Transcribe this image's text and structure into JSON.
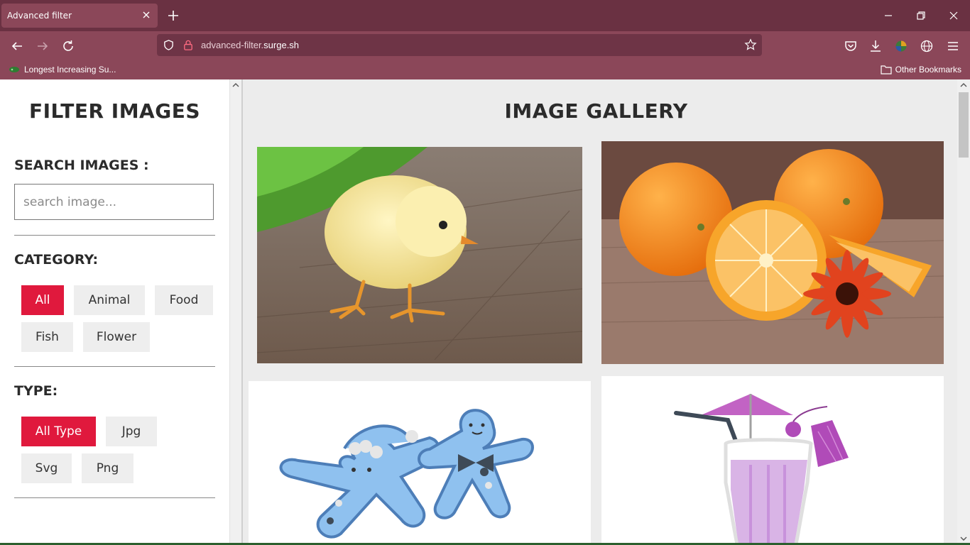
{
  "browser": {
    "tab_title": "Advanced filter",
    "url_prefix": "advanced-filter.",
    "url_domain": "surge.sh",
    "bookmark_item": "Longest Increasing Su...",
    "other_bookmarks": "Other Bookmarks"
  },
  "sidebar": {
    "title": "FILTER IMAGES",
    "search_label": "SEARCH IMAGES :",
    "search_placeholder": "search image...",
    "category_label": "CATEGORY:",
    "categories": [
      "All",
      "Animal",
      "Food",
      "Fish",
      "Flower"
    ],
    "active_category": "All",
    "type_label": "TYPE:",
    "types": [
      "All Type",
      "Jpg",
      "Svg",
      "Png"
    ],
    "active_type": "All Type"
  },
  "gallery": {
    "title": "IMAGE GALLERY",
    "images": [
      {
        "subject": "yellow chick on wooden planks"
      },
      {
        "subject": "oranges with red gerbera flower"
      },
      {
        "subject": "blue gingerbread cookies illustration"
      },
      {
        "subject": "purple cocktail with umbrella illustration"
      }
    ]
  },
  "colors": {
    "accent": "#e0193d",
    "chrome_dark": "#6a3142",
    "chrome": "#8b4759"
  }
}
